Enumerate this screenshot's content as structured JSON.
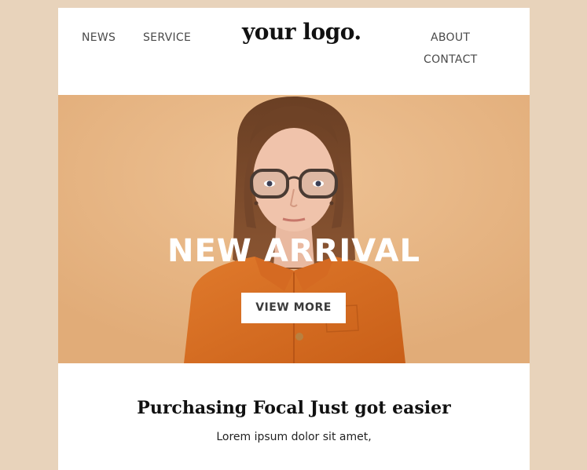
{
  "header": {
    "nav_left": [
      "NEWS",
      "SERVICE"
    ],
    "logo": "your logo.",
    "nav_right": [
      "ABOUT",
      "CONTACT"
    ]
  },
  "hero": {
    "title": "NEW ARRIVAL",
    "button_label": "VIEW MORE",
    "image": "portrait-woman-glasses-orange-shirt"
  },
  "content": {
    "headline": "Purchasing Focal Just got easier",
    "subtext": "Lorem ipsum dolor sit amet,"
  },
  "colors": {
    "page_background": "#e8d3bb",
    "card_background": "#ffffff",
    "hero_background": "#e5b584",
    "shirt": "#d8691f",
    "button_background": "#ffffff",
    "headline_text": "#111111",
    "nav_text": "#4a4a4a"
  }
}
